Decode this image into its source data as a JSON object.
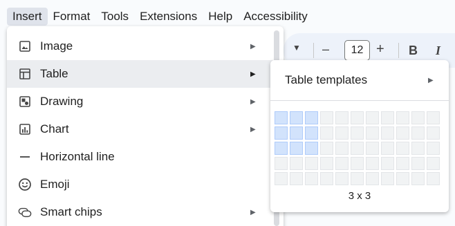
{
  "menubar": {
    "items": [
      "Insert",
      "Format",
      "Tools",
      "Extensions",
      "Help",
      "Accessibility"
    ],
    "active_index": 0
  },
  "toolbar": {
    "font_size": "12",
    "minus": "–",
    "plus": "+",
    "bold": "B",
    "italic": "I"
  },
  "insert_menu": {
    "items": [
      {
        "label": "Image",
        "icon": "image-icon",
        "submenu": true
      },
      {
        "label": "Table",
        "icon": "table-icon",
        "submenu": true,
        "hovered": true
      },
      {
        "label": "Drawing",
        "icon": "drawing-icon",
        "submenu": true
      },
      {
        "label": "Chart",
        "icon": "chart-icon",
        "submenu": true
      },
      {
        "label": "Horizontal line",
        "icon": "horizontal-line-icon",
        "submenu": false
      },
      {
        "label": "Emoji",
        "icon": "emoji-icon",
        "submenu": false
      },
      {
        "label": "Smart chips",
        "icon": "smart-chips-icon",
        "submenu": true
      }
    ]
  },
  "table_submenu": {
    "templates_label": "Table templates",
    "grid_columns": 11,
    "grid_rows": 5,
    "selected_columns": 3,
    "selected_rows": 3,
    "size_label": "3 x 3"
  },
  "colors": {
    "hover_bg": "#ebedf0",
    "menubar_active_bg": "#dfe3eb",
    "cell_selected": "#d2e3fc",
    "cell_default": "#f1f3f4"
  }
}
